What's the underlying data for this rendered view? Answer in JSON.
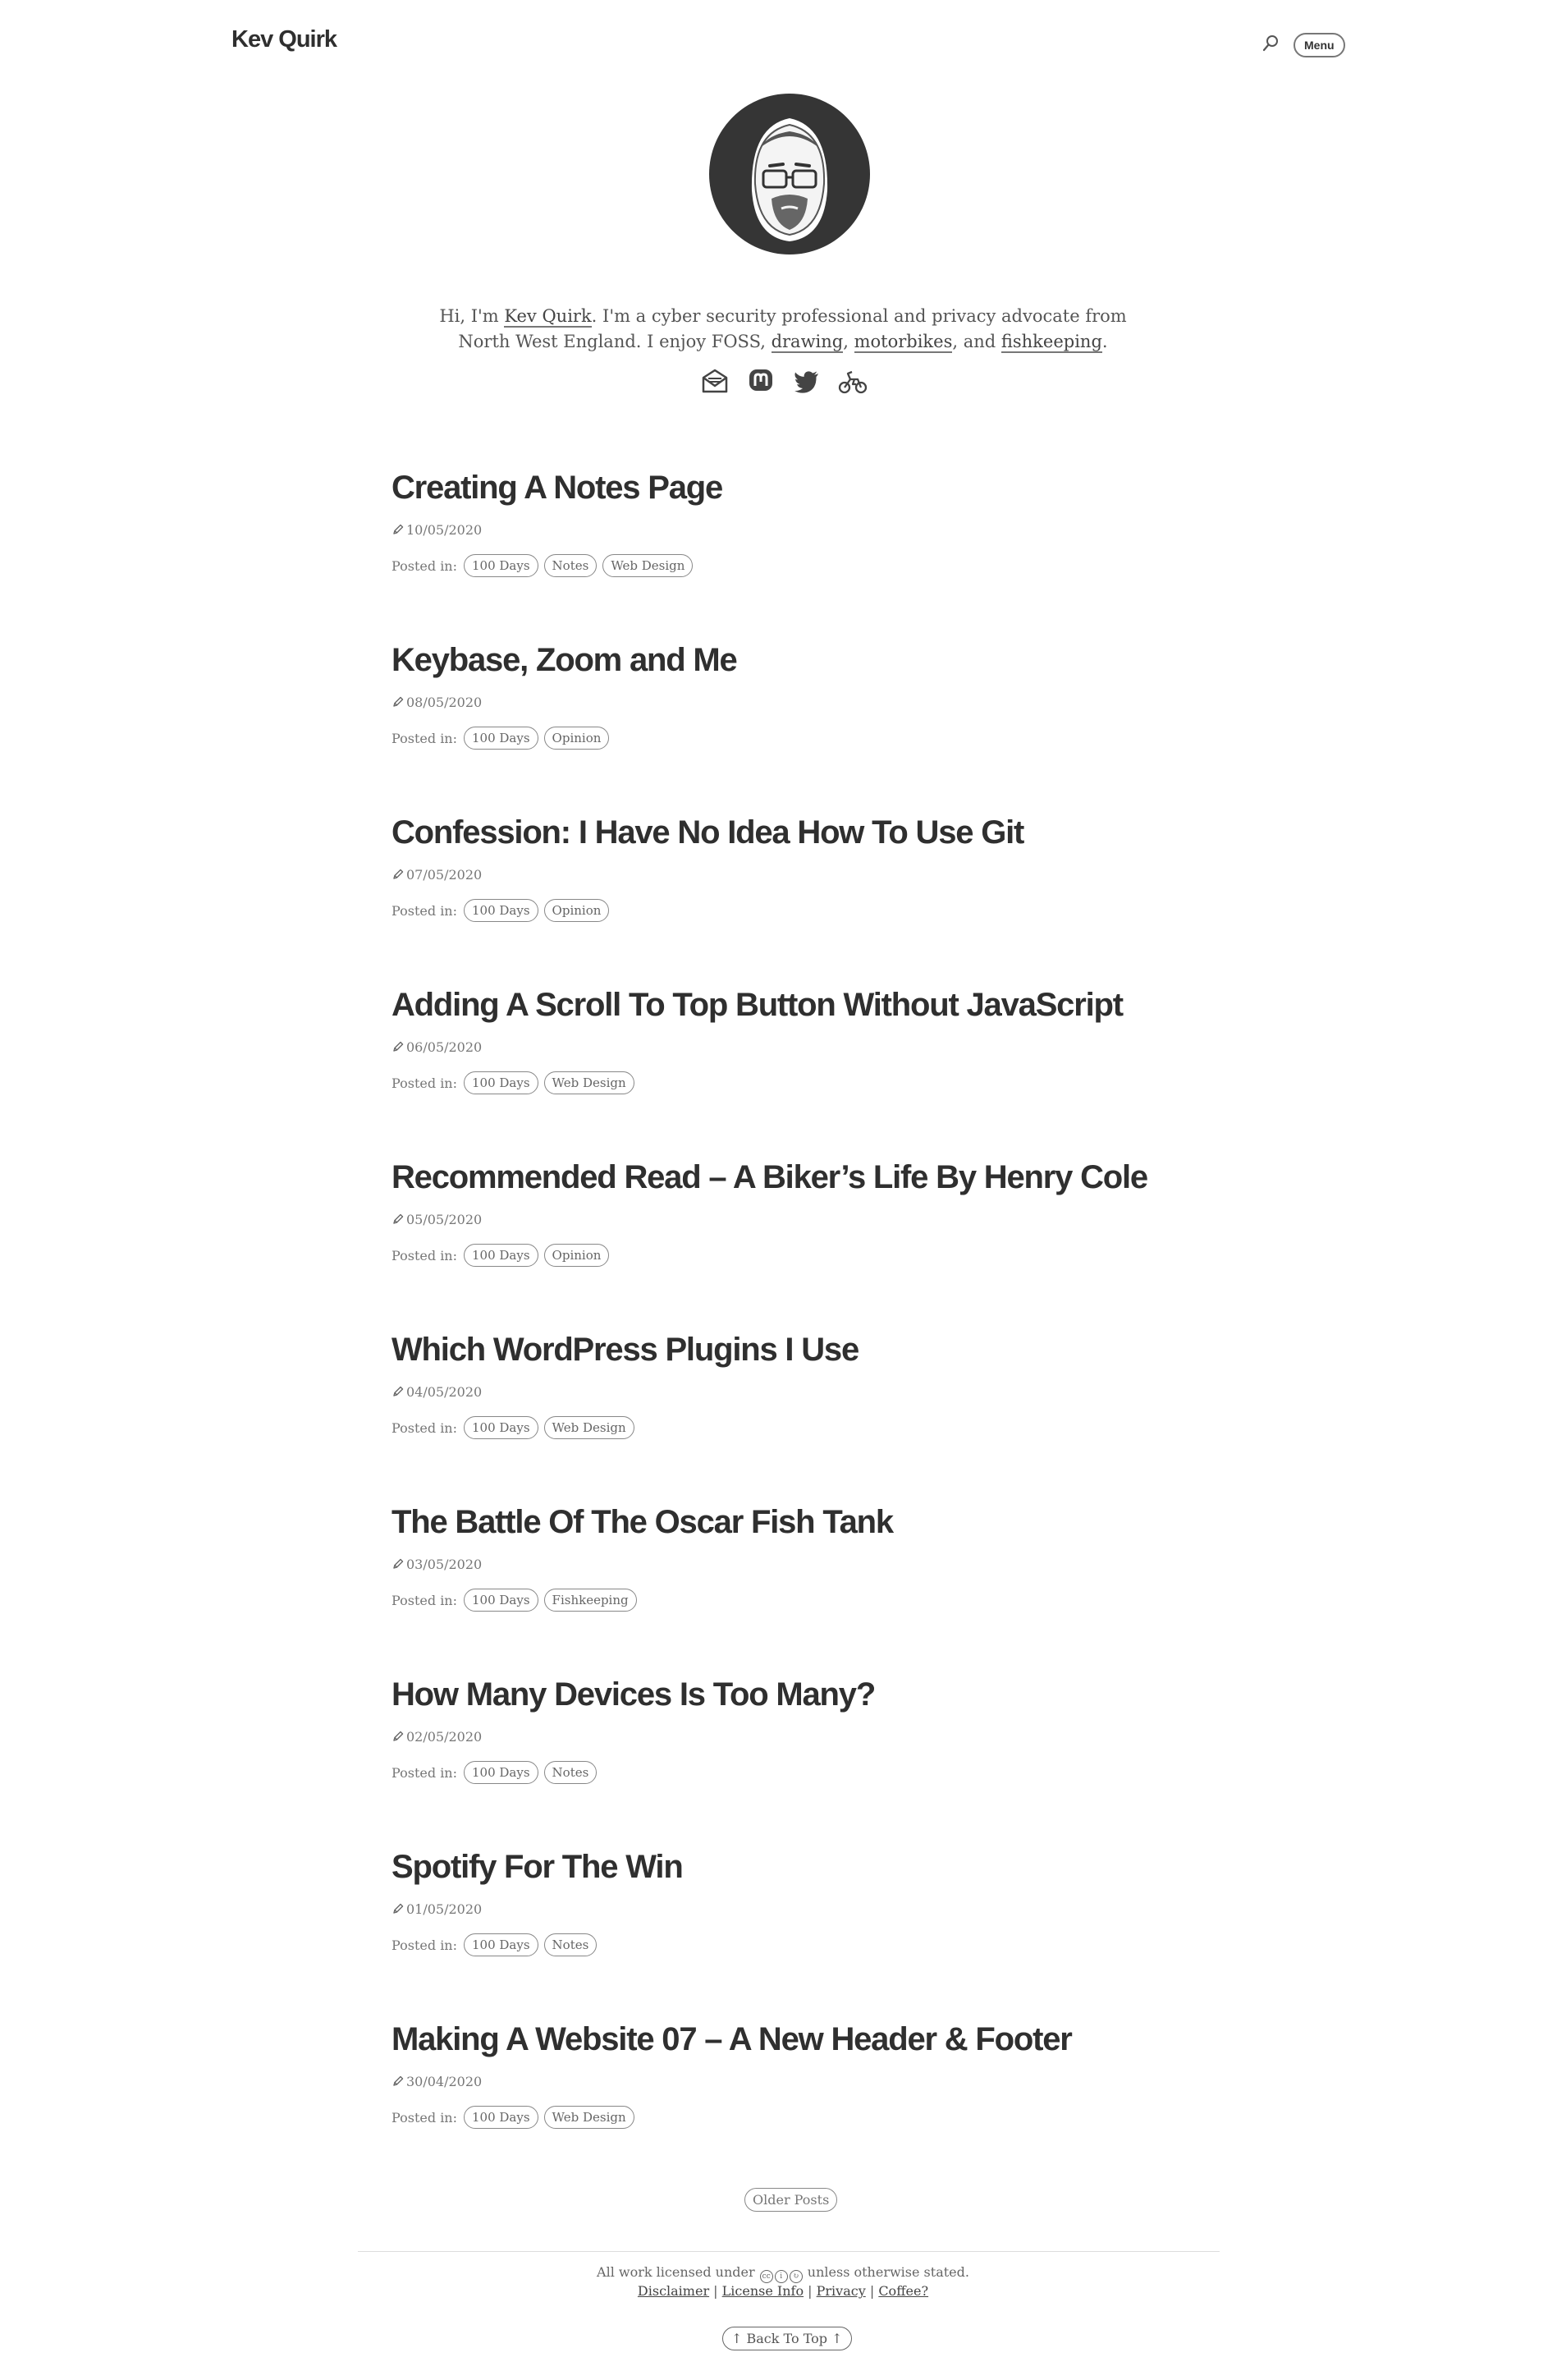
{
  "header": {
    "site_title": "Kev Quirk",
    "menu_label": "Menu",
    "search_icon": "search-icon"
  },
  "intro": {
    "bio_prefix": "Hi, I'm ",
    "name_link": "Kev Quirk",
    "bio_mid": ". I'm a cyber security professional and privacy advocate from North West England. I enjoy FOSS, ",
    "link_drawing": "drawing",
    "sep1": ", ",
    "link_motorbikes": "motorbikes",
    "sep2": ", and ",
    "link_fishkeeping": "fishkeeping",
    "bio_end": ".",
    "social_icons": [
      "email-icon",
      "mastodon-icon",
      "twitter-icon",
      "motorbike-icon"
    ]
  },
  "posted_in_label": "Posted in:",
  "posts": [
    {
      "title": "Creating A Notes Page",
      "date": "10/05/2020",
      "tags": [
        "100 Days",
        "Notes",
        "Web Design"
      ]
    },
    {
      "title": "Keybase, Zoom and Me",
      "date": "08/05/2020",
      "tags": [
        "100 Days",
        "Opinion"
      ]
    },
    {
      "title": "Confession: I Have No Idea How To Use Git",
      "date": "07/05/2020",
      "tags": [
        "100 Days",
        "Opinion"
      ]
    },
    {
      "title": "Adding A Scroll To Top Button Without JavaScript",
      "date": "06/05/2020",
      "tags": [
        "100 Days",
        "Web Design"
      ]
    },
    {
      "title": "Recommended Read – A Biker’s Life By Henry Cole",
      "date": "05/05/2020",
      "tags": [
        "100 Days",
        "Opinion"
      ]
    },
    {
      "title": "Which WordPress Plugins I Use",
      "date": "04/05/2020",
      "tags": [
        "100 Days",
        "Web Design"
      ]
    },
    {
      "title": "The Battle Of The Oscar Fish Tank",
      "date": "03/05/2020",
      "tags": [
        "100 Days",
        "Fishkeeping"
      ]
    },
    {
      "title": "How Many Devices Is Too Many?",
      "date": "02/05/2020",
      "tags": [
        "100 Days",
        "Notes"
      ]
    },
    {
      "title": "Spotify For The Win",
      "date": "01/05/2020",
      "tags": [
        "100 Days",
        "Notes"
      ]
    },
    {
      "title": "Making A Website 07 – A New Header & Footer",
      "date": "30/04/2020",
      "tags": [
        "100 Days",
        "Web Design"
      ]
    }
  ],
  "pagination": {
    "older_label": "Older Posts"
  },
  "footer": {
    "license_prefix": "All work licensed under ",
    "license_suffix": " unless otherwise stated.",
    "links": [
      "Disclaimer",
      "License Info",
      "Privacy",
      "Coffee?"
    ],
    "back_to_top": "Back To Top"
  }
}
